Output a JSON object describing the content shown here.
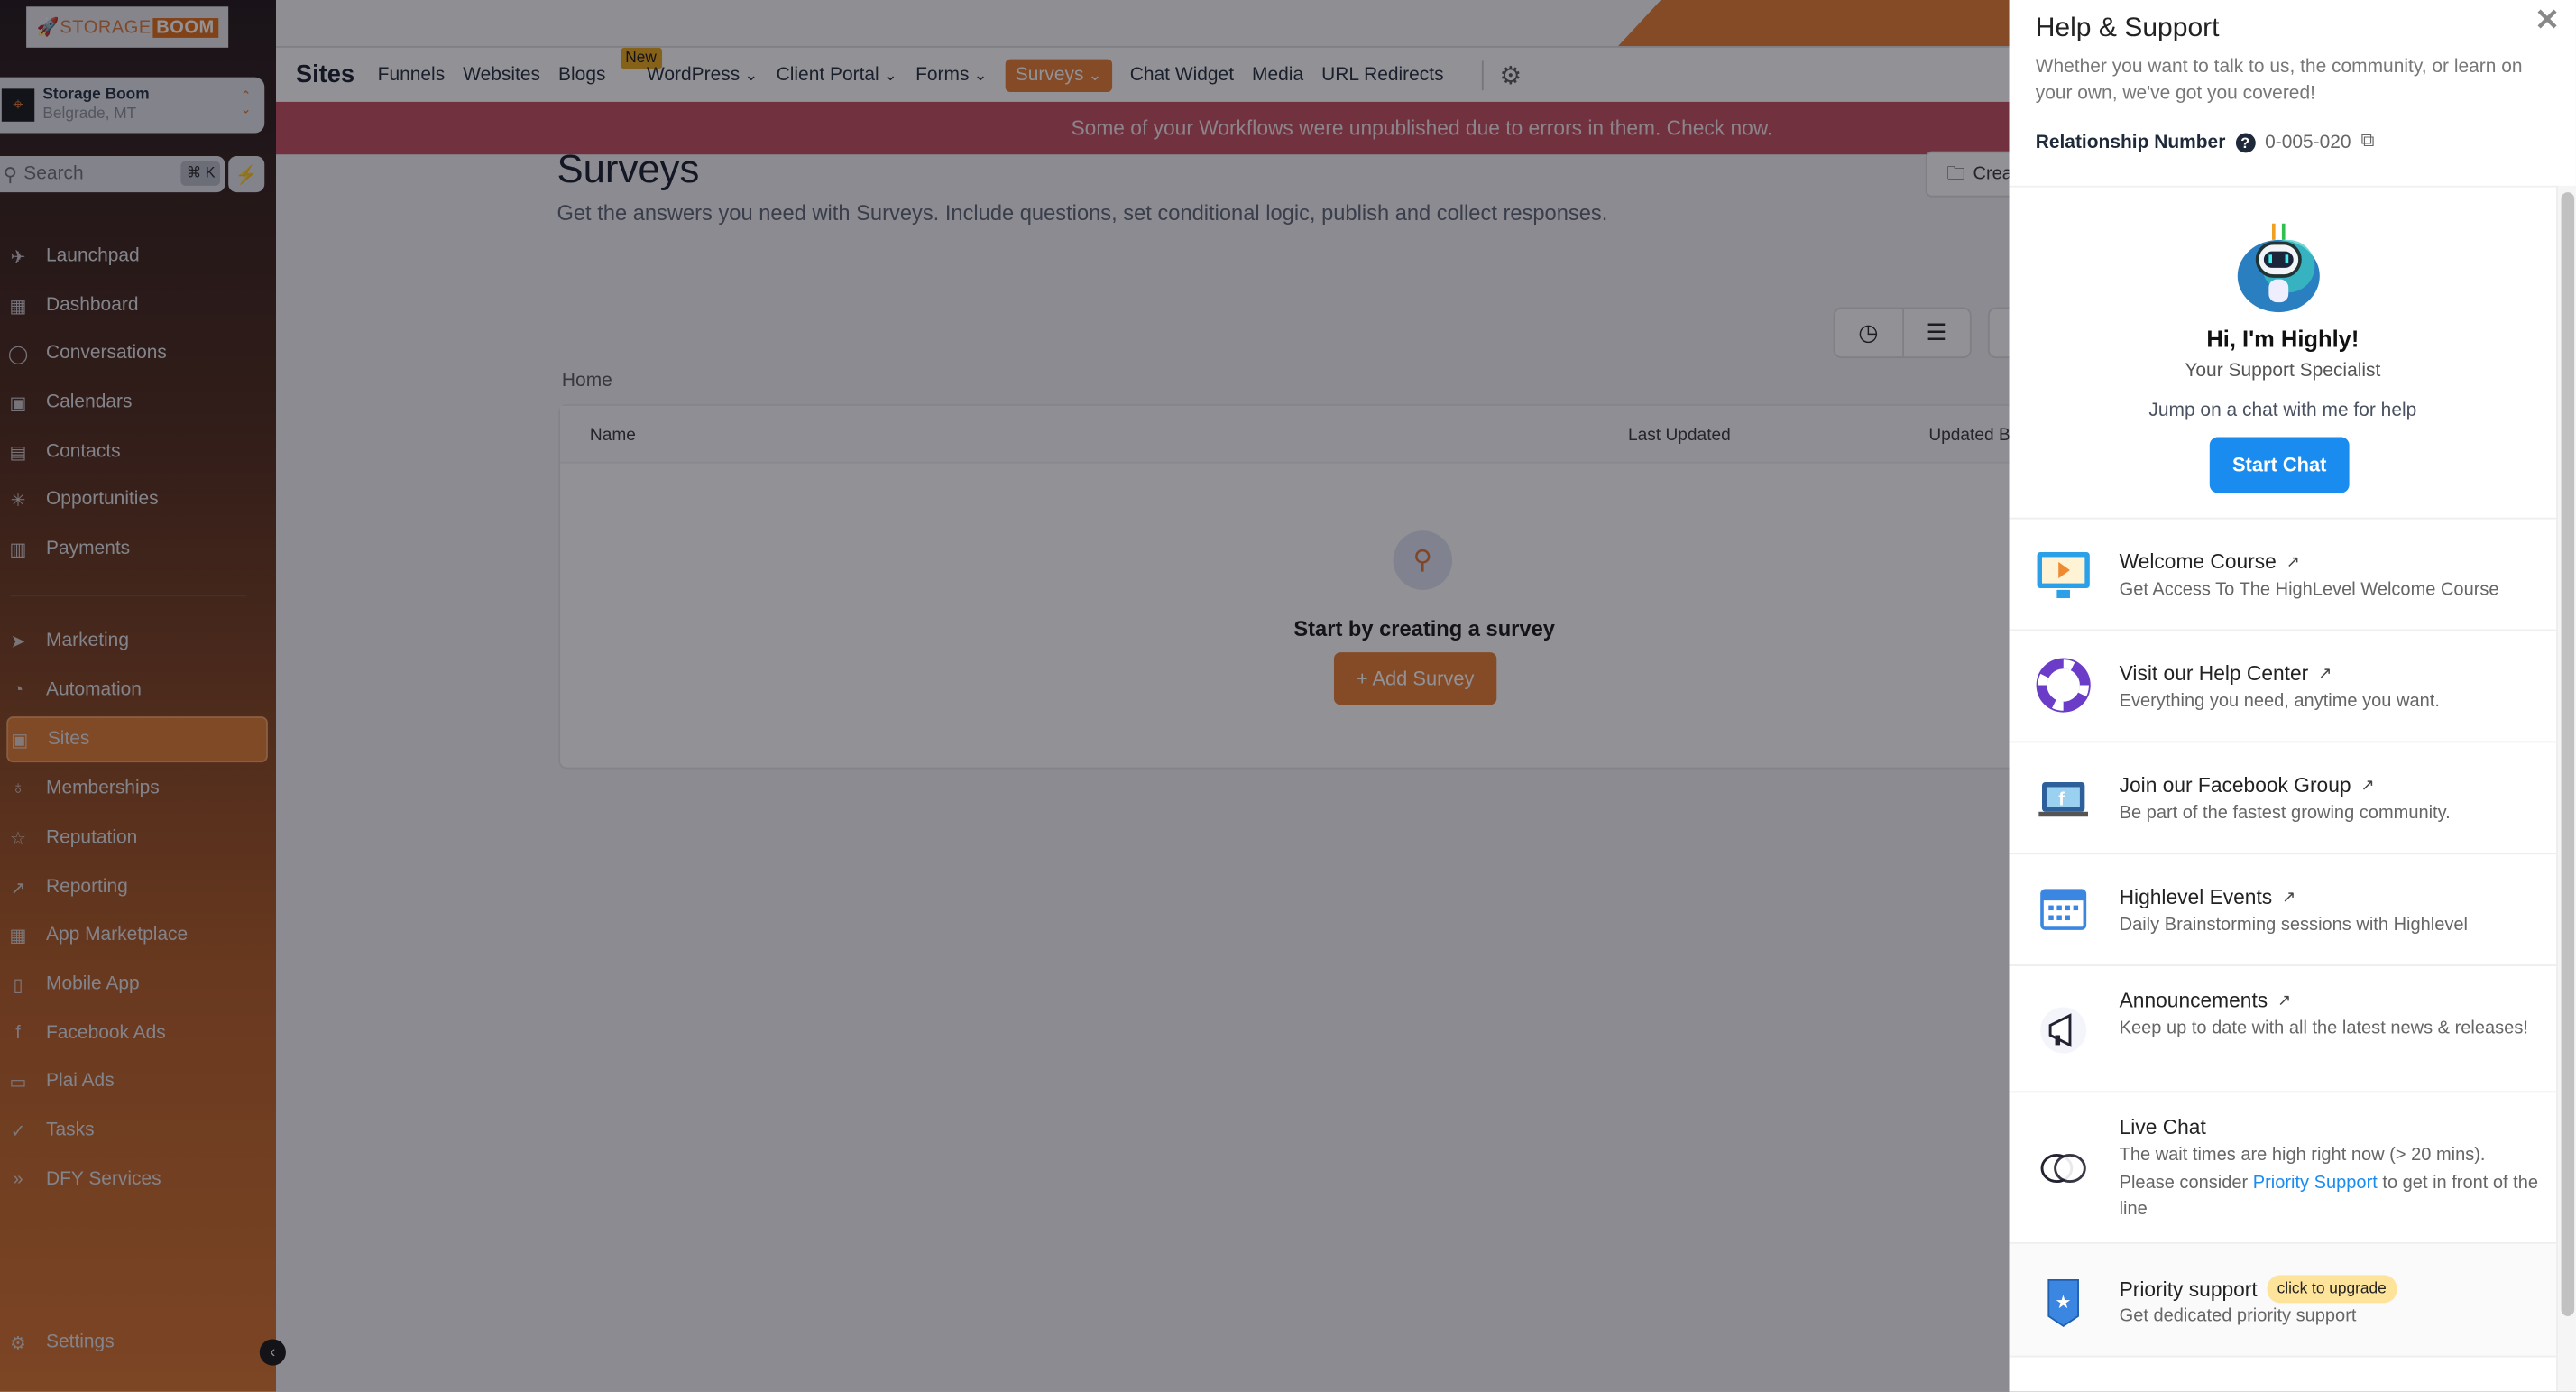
{
  "sidebar": {
    "logo": {
      "text_a": "STORAGE",
      "text_b": "BOOM"
    },
    "account": {
      "name": "Storage Boom",
      "location": "Belgrade, MT"
    },
    "search": {
      "placeholder": "Search",
      "shortcut": "⌘ K"
    },
    "items": [
      {
        "label": "Launchpad",
        "icon": "rocket-icon"
      },
      {
        "label": "Dashboard",
        "icon": "grid-icon"
      },
      {
        "label": "Conversations",
        "icon": "chat-icon"
      },
      {
        "label": "Calendars",
        "icon": "calendar-icon"
      },
      {
        "label": "Contacts",
        "icon": "contacts-icon"
      },
      {
        "label": "Opportunities",
        "icon": "opportunities-icon"
      },
      {
        "label": "Payments",
        "icon": "payments-icon"
      },
      {
        "label": "Marketing",
        "icon": "send-icon"
      },
      {
        "label": "Automation",
        "icon": "automation-icon"
      },
      {
        "label": "Sites",
        "icon": "sites-icon",
        "active": true
      },
      {
        "label": "Memberships",
        "icon": "memberships-icon"
      },
      {
        "label": "Reputation",
        "icon": "star-icon"
      },
      {
        "label": "Reporting",
        "icon": "chart-icon"
      },
      {
        "label": "App Marketplace",
        "icon": "apps-icon"
      },
      {
        "label": "Mobile App",
        "icon": "mobile-icon"
      },
      {
        "label": "Facebook Ads",
        "icon": "facebook-icon"
      },
      {
        "label": "Plai Ads",
        "icon": "ads-icon"
      },
      {
        "label": "Tasks",
        "icon": "check-icon"
      },
      {
        "label": "DFY Services",
        "icon": "chevrons-icon"
      }
    ],
    "settings": "Settings"
  },
  "nav": {
    "title": "Sites",
    "links": [
      {
        "label": "Funnels"
      },
      {
        "label": "Websites"
      },
      {
        "label": "Blogs",
        "badge": "New"
      },
      {
        "label": "WordPress",
        "dropdown": true
      },
      {
        "label": "Client Portal",
        "dropdown": true
      },
      {
        "label": "Forms",
        "dropdown": true
      },
      {
        "label": "Surveys",
        "dropdown": true,
        "active": true
      },
      {
        "label": "Chat Widget"
      },
      {
        "label": "Media"
      },
      {
        "label": "URL Redirects"
      }
    ]
  },
  "banner": "Some of your Workflows were unpublished due to errors in them. Check now.",
  "page": {
    "title": "Surveys",
    "description": "Get the answers you need with Surveys. Include questions, set conditional logic, publish and collect responses.",
    "create_label": "Crea",
    "breadcrumb": "Home",
    "columns": [
      "Name",
      "Last Updated",
      "Updated B"
    ],
    "empty_title": "Start by creating a survey",
    "add_label": "+ Add Survey"
  },
  "help": {
    "title": "Help & Support",
    "subtitle": "Whether you want to talk to us, the community, or learn on your own, we've got you covered!",
    "relationship_label": "Relationship Number",
    "relationship_number": "0-005-020",
    "bot_title": "Hi, I'm Highly!",
    "bot_role": "Your Support Specialist",
    "bot_prompt": "Jump on a chat with me for help",
    "start_chat": "Start Chat",
    "items": [
      {
        "title": "Welcome Course",
        "desc": "Get Access To The HighLevel Welcome Course"
      },
      {
        "title": "Visit our Help Center",
        "desc": "Everything you need, anytime you want."
      },
      {
        "title": "Join our Facebook Group",
        "desc": "Be part of the fastest growing community."
      },
      {
        "title": "Highlevel Events",
        "desc": "Daily Brainstorming sessions with Highlevel"
      },
      {
        "title": "Announcements",
        "desc": "Keep up to date with all the latest news & releases!"
      },
      {
        "title": "Live Chat",
        "desc_a": "The wait times are high right now (> 20 mins). Please consider ",
        "desc_link": "Priority Support",
        "desc_b": " to get in front of the line"
      },
      {
        "title": "Priority support",
        "badge": "click to upgrade",
        "desc": "Get dedicated priority support"
      }
    ]
  },
  "colors": {
    "accent": "#e8792c",
    "banner": "#c24a5b",
    "primary_blue": "#1a8cf0",
    "upgrade_badge": "#fde49a"
  }
}
